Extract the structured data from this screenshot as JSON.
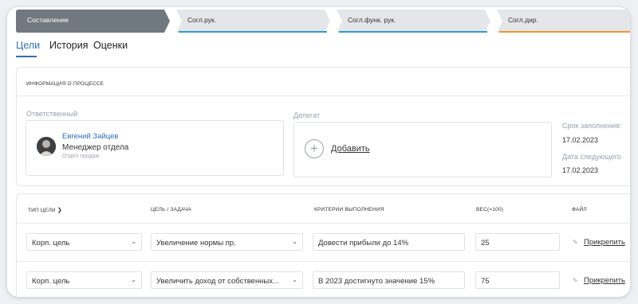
{
  "stages": [
    {
      "label": "Составление",
      "state": "active",
      "color": "#707880"
    },
    {
      "label": "Согл.рук.",
      "state": "inactive",
      "accent": "#2e9bd6"
    },
    {
      "label": "Согл.функ. рук.",
      "state": "inactive",
      "accent": "#2e9bd6"
    },
    {
      "label": "Согл.дир.",
      "state": "inactive",
      "accent": "#f0952a"
    }
  ],
  "tabs": [
    {
      "label": "Цели",
      "active": true
    },
    {
      "label": "История",
      "active": false
    },
    {
      "label": "Оценки",
      "active": false
    }
  ],
  "process": {
    "title": "ИНФОРМАЦИЯ О ПРОЦЕССЕ",
    "responsible_label": "Ответственный",
    "responsible": {
      "name": "Евгений Зайцев",
      "role": "Менеджер отдела",
      "dept": "Отдел продаж"
    },
    "delegate_label": "Делегат",
    "add_label": "Добавить",
    "deadline_label": "Срок заполнения:",
    "deadline_value": "17.02.2023",
    "next_label": "Дата следующего",
    "next_value": "17.02.2023"
  },
  "table": {
    "headers": {
      "type": "ТИП ЦЕЛИ",
      "goal": "ЦЕЛЬ / ЗАДАЧА",
      "criteria": "КРИТЕРИИ ВЫПОЛНЕНИЯ",
      "weight": "ВЕС(=100)",
      "file": "ФАЙЛ"
    },
    "rows": [
      {
        "type": "Корп. цель",
        "goal": "Увеличение нормы пр.",
        "criteria": "Довести прибыли до 14%",
        "weight": "25",
        "attach": "Прикрепить"
      },
      {
        "type": "Корп. цель",
        "goal": "Увеличить доход от собственных...",
        "criteria": "В 2023 достигнуто значение 15%",
        "weight": "75",
        "attach": "Прикрепить"
      }
    ]
  },
  "colors": {
    "accent": "#2e6fb5",
    "stage_active": "#707880"
  }
}
